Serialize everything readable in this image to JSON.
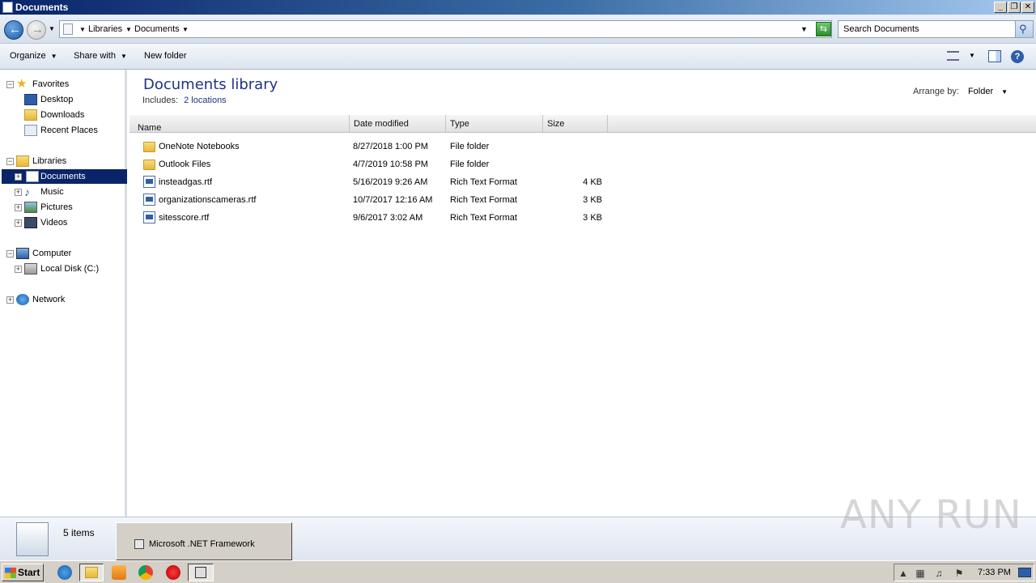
{
  "window": {
    "title": "Documents"
  },
  "address": {
    "crumbs": [
      "Libraries",
      "Documents"
    ],
    "search_placeholder": "Search Documents"
  },
  "toolbar": {
    "organize": "Organize",
    "share_with": "Share with",
    "new_folder": "New folder"
  },
  "nav": {
    "favorites": "Favorites",
    "desktop": "Desktop",
    "downloads": "Downloads",
    "recent_places": "Recent Places",
    "libraries": "Libraries",
    "documents": "Documents",
    "music": "Music",
    "pictures": "Pictures",
    "videos": "Videos",
    "computer": "Computer",
    "local_disk": "Local Disk (C:)",
    "network": "Network"
  },
  "library": {
    "title": "Documents library",
    "includes_label": "Includes:",
    "includes_value": "2 locations",
    "arrange_label": "Arrange by:",
    "arrange_value": "Folder"
  },
  "columns": {
    "name": "Name",
    "date": "Date modified",
    "type": "Type",
    "size": "Size"
  },
  "files": [
    {
      "name": "OneNote Notebooks",
      "date": "8/27/2018 1:00 PM",
      "type": "File folder",
      "size": "",
      "icon": "folder-icon"
    },
    {
      "name": "Outlook Files",
      "date": "4/7/2019 10:58 PM",
      "type": "File folder",
      "size": "",
      "icon": "folder-icon"
    },
    {
      "name": "insteadgas.rtf",
      "date": "5/16/2019 9:26 AM",
      "type": "Rich Text Format",
      "size": "4 KB",
      "icon": "rtf-file-icon"
    },
    {
      "name": "organizationscameras.rtf",
      "date": "10/7/2017 12:16 AM",
      "type": "Rich Text Format",
      "size": "3 KB",
      "icon": "rtf-file-icon"
    },
    {
      "name": "sitesscore.rtf",
      "date": "9/6/2017 3:02 AM",
      "type": "Rich Text Format",
      "size": "3 KB",
      "icon": "rtf-file-icon"
    }
  ],
  "details": {
    "item_count": "5 items"
  },
  "popup": {
    "label": "Microsoft .NET Framework"
  },
  "watermark": "ANY RUN",
  "taskbar": {
    "start": "Start",
    "clock": "7:33 PM"
  }
}
